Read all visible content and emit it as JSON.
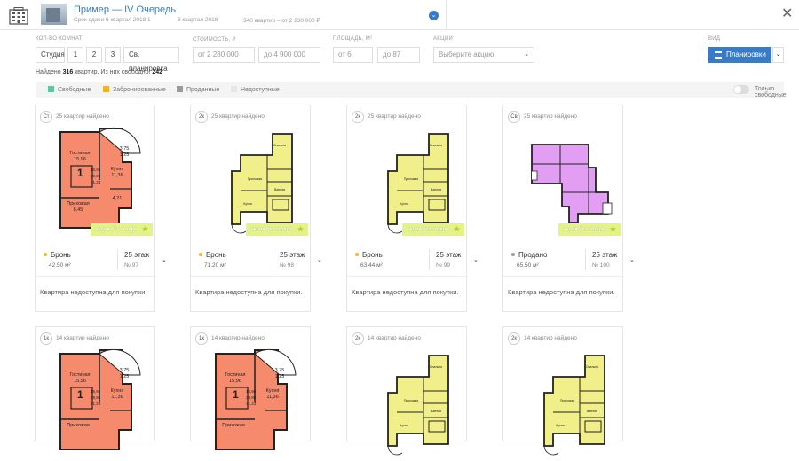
{
  "header": {
    "title": "Пример — IV Очередь",
    "deadline": "Срок сдачи 6 квартал 2018 1",
    "quarter": "6 квартал 2018",
    "flats": "340 квартир – от 2 230 000 ₽"
  },
  "filters": {
    "rooms_label": "КОЛ-ВО КОМНАТ",
    "rooms": [
      "Студия",
      "1",
      "2",
      "3",
      "Св. планировка"
    ],
    "price_label": "СТОИМОСТЬ, ₽",
    "price_from": "от  2 280 000",
    "price_to": "до  4 900 000",
    "area_label": "ПЛОЩАДЬ, М²",
    "area_from": "от  6",
    "area_to": "до  87",
    "promo_label": "АКЦИИ",
    "promo_placeholder": "Выберите акцию",
    "view_label": "ВИД",
    "view_button": "Планировки"
  },
  "found": {
    "prefix": "Найдено",
    "total": "316",
    "middle": "квартир. Из них свободно:",
    "free": "242"
  },
  "legend": {
    "items": [
      {
        "label": "Свободные",
        "color": "#5cc8a5"
      },
      {
        "label": "Забронированные",
        "color": "#f5b323"
      },
      {
        "label": "Проданные",
        "color": "#9a9a9a"
      },
      {
        "label": "Недоступные",
        "color": "#e6e6e6"
      }
    ],
    "toggle_label": "Только свободные"
  },
  "cards": [
    {
      "badge": "Ст",
      "count": "25 квартир найдено",
      "plan": "orange",
      "promo": "акция без тизера",
      "status": "Бронь",
      "status_color": "#f5b323",
      "area": "42.50 м²",
      "floor": "25 этаж",
      "num": "№ 97",
      "note": "Квартира недоступна для покупки.",
      "label1": "Гостиная",
      "val1": "15,96",
      "label2": "Кухня",
      "val2": "11,36",
      "label3": "Прихожая",
      "val3": "8,45",
      "s1": "3,75",
      "s2": "1,25",
      "s3": "4,21",
      "k1": "15,96",
      "k2": "39,98",
      "k3": "41,23"
    },
    {
      "badge": "2к",
      "count": "25 квартир найдено",
      "plan": "yellow",
      "promo": "акция без тизера",
      "status": "Бронь",
      "status_color": "#f5b323",
      "area": "71.20 м²",
      "floor": "25 этаж",
      "num": "№ 98",
      "note": "Квартира недоступна для покупки."
    },
    {
      "badge": "2к",
      "count": "25 квартир найдено",
      "plan": "yellow",
      "promo": "акция без тизера",
      "status": "Бронь",
      "status_color": "#f5b323",
      "area": "63.44 м²",
      "floor": "25 этаж",
      "num": "№ 99",
      "note": "Квартира недоступна для покупки."
    },
    {
      "badge": "Св",
      "count": "25 квартир найдено",
      "plan": "pink",
      "promo": "акция без тизера",
      "status": "Продано",
      "status_color": "#9a9a9a",
      "area": "65.50 м²",
      "floor": "25 этаж",
      "num": "№ 100",
      "note": "Квартира недоступна для покупки."
    },
    {
      "badge": "1к",
      "count": "14 квартир найдено",
      "plan": "orange",
      "label1": "Гостиная",
      "val1": "15,96",
      "label2": "Кухня",
      "val2": "11,36",
      "label3": "Прихожая",
      "s1": "3,75",
      "s2": "1,25",
      "k1": "15,96",
      "k2": "39,98",
      "k3": "41,23"
    },
    {
      "badge": "1к",
      "count": "14 квартир найдено",
      "plan": "orange",
      "label1": "Гостиная",
      "val1": "15,96",
      "label2": "Кухня",
      "val2": "11,36",
      "label3": "Прихожая",
      "s1": "3,75",
      "s2": "1,25",
      "k1": "15,96",
      "k2": "39,98",
      "k3": "41,23"
    },
    {
      "badge": "2к",
      "count": "14 квартир найдено",
      "plan": "yellow"
    },
    {
      "badge": "2к",
      "count": "14 квартир найдено",
      "plan": "yellow"
    }
  ]
}
